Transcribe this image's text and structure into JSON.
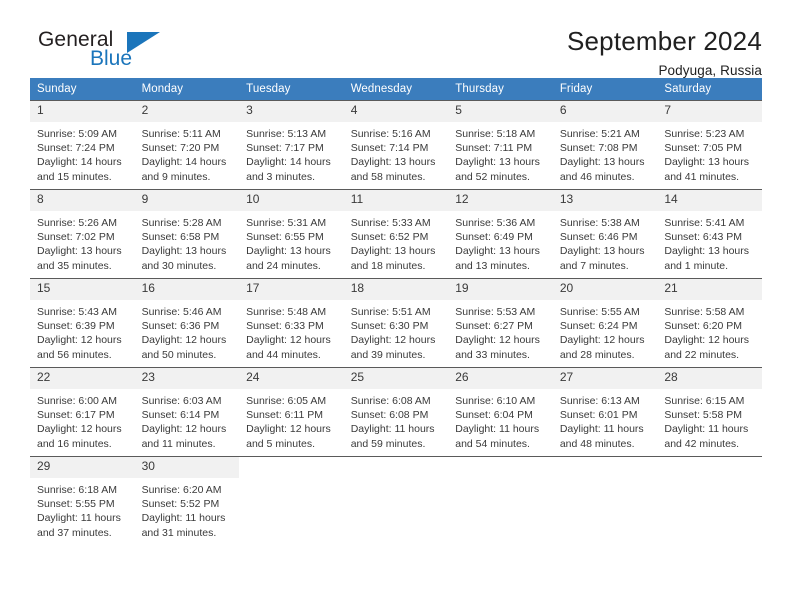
{
  "brand": {
    "name_part1": "General",
    "name_part2": "Blue"
  },
  "header": {
    "title": "September 2024",
    "subtitle": "Podyuga, Russia"
  },
  "calendar": {
    "weekday_headers": [
      "Sunday",
      "Monday",
      "Tuesday",
      "Wednesday",
      "Thursday",
      "Friday",
      "Saturday"
    ],
    "labels": {
      "sunrise": "Sunrise:",
      "sunset": "Sunset:",
      "daylight": "Daylight:"
    },
    "accent_color": "#3b7dbd",
    "daynum_bg": "#f1f1f1",
    "weeks": [
      [
        {
          "day": "1",
          "sunrise": "Sunrise: 5:09 AM",
          "sunset": "Sunset: 7:24 PM",
          "daylight_line1": "Daylight: 14 hours",
          "daylight_line2": "and 15 minutes."
        },
        {
          "day": "2",
          "sunrise": "Sunrise: 5:11 AM",
          "sunset": "Sunset: 7:20 PM",
          "daylight_line1": "Daylight: 14 hours",
          "daylight_line2": "and 9 minutes."
        },
        {
          "day": "3",
          "sunrise": "Sunrise: 5:13 AM",
          "sunset": "Sunset: 7:17 PM",
          "daylight_line1": "Daylight: 14 hours",
          "daylight_line2": "and 3 minutes."
        },
        {
          "day": "4",
          "sunrise": "Sunrise: 5:16 AM",
          "sunset": "Sunset: 7:14 PM",
          "daylight_line1": "Daylight: 13 hours",
          "daylight_line2": "and 58 minutes."
        },
        {
          "day": "5",
          "sunrise": "Sunrise: 5:18 AM",
          "sunset": "Sunset: 7:11 PM",
          "daylight_line1": "Daylight: 13 hours",
          "daylight_line2": "and 52 minutes."
        },
        {
          "day": "6",
          "sunrise": "Sunrise: 5:21 AM",
          "sunset": "Sunset: 7:08 PM",
          "daylight_line1": "Daylight: 13 hours",
          "daylight_line2": "and 46 minutes."
        },
        {
          "day": "7",
          "sunrise": "Sunrise: 5:23 AM",
          "sunset": "Sunset: 7:05 PM",
          "daylight_line1": "Daylight: 13 hours",
          "daylight_line2": "and 41 minutes."
        }
      ],
      [
        {
          "day": "8",
          "sunrise": "Sunrise: 5:26 AM",
          "sunset": "Sunset: 7:02 PM",
          "daylight_line1": "Daylight: 13 hours",
          "daylight_line2": "and 35 minutes."
        },
        {
          "day": "9",
          "sunrise": "Sunrise: 5:28 AM",
          "sunset": "Sunset: 6:58 PM",
          "daylight_line1": "Daylight: 13 hours",
          "daylight_line2": "and 30 minutes."
        },
        {
          "day": "10",
          "sunrise": "Sunrise: 5:31 AM",
          "sunset": "Sunset: 6:55 PM",
          "daylight_line1": "Daylight: 13 hours",
          "daylight_line2": "and 24 minutes."
        },
        {
          "day": "11",
          "sunrise": "Sunrise: 5:33 AM",
          "sunset": "Sunset: 6:52 PM",
          "daylight_line1": "Daylight: 13 hours",
          "daylight_line2": "and 18 minutes."
        },
        {
          "day": "12",
          "sunrise": "Sunrise: 5:36 AM",
          "sunset": "Sunset: 6:49 PM",
          "daylight_line1": "Daylight: 13 hours",
          "daylight_line2": "and 13 minutes."
        },
        {
          "day": "13",
          "sunrise": "Sunrise: 5:38 AM",
          "sunset": "Sunset: 6:46 PM",
          "daylight_line1": "Daylight: 13 hours",
          "daylight_line2": "and 7 minutes."
        },
        {
          "day": "14",
          "sunrise": "Sunrise: 5:41 AM",
          "sunset": "Sunset: 6:43 PM",
          "daylight_line1": "Daylight: 13 hours",
          "daylight_line2": "and 1 minute."
        }
      ],
      [
        {
          "day": "15",
          "sunrise": "Sunrise: 5:43 AM",
          "sunset": "Sunset: 6:39 PM",
          "daylight_line1": "Daylight: 12 hours",
          "daylight_line2": "and 56 minutes."
        },
        {
          "day": "16",
          "sunrise": "Sunrise: 5:46 AM",
          "sunset": "Sunset: 6:36 PM",
          "daylight_line1": "Daylight: 12 hours",
          "daylight_line2": "and 50 minutes."
        },
        {
          "day": "17",
          "sunrise": "Sunrise: 5:48 AM",
          "sunset": "Sunset: 6:33 PM",
          "daylight_line1": "Daylight: 12 hours",
          "daylight_line2": "and 44 minutes."
        },
        {
          "day": "18",
          "sunrise": "Sunrise: 5:51 AM",
          "sunset": "Sunset: 6:30 PM",
          "daylight_line1": "Daylight: 12 hours",
          "daylight_line2": "and 39 minutes."
        },
        {
          "day": "19",
          "sunrise": "Sunrise: 5:53 AM",
          "sunset": "Sunset: 6:27 PM",
          "daylight_line1": "Daylight: 12 hours",
          "daylight_line2": "and 33 minutes."
        },
        {
          "day": "20",
          "sunrise": "Sunrise: 5:55 AM",
          "sunset": "Sunset: 6:24 PM",
          "daylight_line1": "Daylight: 12 hours",
          "daylight_line2": "and 28 minutes."
        },
        {
          "day": "21",
          "sunrise": "Sunrise: 5:58 AM",
          "sunset": "Sunset: 6:20 PM",
          "daylight_line1": "Daylight: 12 hours",
          "daylight_line2": "and 22 minutes."
        }
      ],
      [
        {
          "day": "22",
          "sunrise": "Sunrise: 6:00 AM",
          "sunset": "Sunset: 6:17 PM",
          "daylight_line1": "Daylight: 12 hours",
          "daylight_line2": "and 16 minutes."
        },
        {
          "day": "23",
          "sunrise": "Sunrise: 6:03 AM",
          "sunset": "Sunset: 6:14 PM",
          "daylight_line1": "Daylight: 12 hours",
          "daylight_line2": "and 11 minutes."
        },
        {
          "day": "24",
          "sunrise": "Sunrise: 6:05 AM",
          "sunset": "Sunset: 6:11 PM",
          "daylight_line1": "Daylight: 12 hours",
          "daylight_line2": "and 5 minutes."
        },
        {
          "day": "25",
          "sunrise": "Sunrise: 6:08 AM",
          "sunset": "Sunset: 6:08 PM",
          "daylight_line1": "Daylight: 11 hours",
          "daylight_line2": "and 59 minutes."
        },
        {
          "day": "26",
          "sunrise": "Sunrise: 6:10 AM",
          "sunset": "Sunset: 6:04 PM",
          "daylight_line1": "Daylight: 11 hours",
          "daylight_line2": "and 54 minutes."
        },
        {
          "day": "27",
          "sunrise": "Sunrise: 6:13 AM",
          "sunset": "Sunset: 6:01 PM",
          "daylight_line1": "Daylight: 11 hours",
          "daylight_line2": "and 48 minutes."
        },
        {
          "day": "28",
          "sunrise": "Sunrise: 6:15 AM",
          "sunset": "Sunset: 5:58 PM",
          "daylight_line1": "Daylight: 11 hours",
          "daylight_line2": "and 42 minutes."
        }
      ],
      [
        {
          "day": "29",
          "sunrise": "Sunrise: 6:18 AM",
          "sunset": "Sunset: 5:55 PM",
          "daylight_line1": "Daylight: 11 hours",
          "daylight_line2": "and 37 minutes."
        },
        {
          "day": "30",
          "sunrise": "Sunrise: 6:20 AM",
          "sunset": "Sunset: 5:52 PM",
          "daylight_line1": "Daylight: 11 hours",
          "daylight_line2": "and 31 minutes."
        },
        {
          "day": "",
          "sunrise": "",
          "sunset": "",
          "daylight_line1": "",
          "daylight_line2": ""
        },
        {
          "day": "",
          "sunrise": "",
          "sunset": "",
          "daylight_line1": "",
          "daylight_line2": ""
        },
        {
          "day": "",
          "sunrise": "",
          "sunset": "",
          "daylight_line1": "",
          "daylight_line2": ""
        },
        {
          "day": "",
          "sunrise": "",
          "sunset": "",
          "daylight_line1": "",
          "daylight_line2": ""
        },
        {
          "day": "",
          "sunrise": "",
          "sunset": "",
          "daylight_line1": "",
          "daylight_line2": ""
        }
      ]
    ]
  }
}
